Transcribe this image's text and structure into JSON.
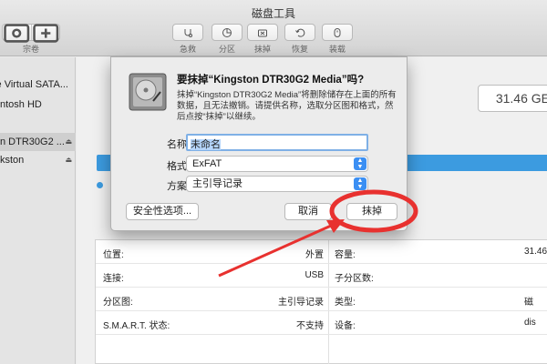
{
  "window": {
    "title": "磁盘工具"
  },
  "toolbar": {
    "volume_label": "宗卷",
    "items": [
      {
        "label": "急救",
        "icon": "stethoscope-icon"
      },
      {
        "label": "分区",
        "icon": "pie-chart-icon"
      },
      {
        "label": "抹掉",
        "icon": "erase-icon"
      },
      {
        "label": "恢复",
        "icon": "restore-icon"
      },
      {
        "label": "装载",
        "icon": "mount-icon"
      }
    ]
  },
  "sidebar": {
    "items": [
      {
        "label": "e Virtual SATA..."
      },
      {
        "label": "ntosh HD"
      },
      {
        "label": "n DTR30G2 ...",
        "selected": true
      },
      {
        "label": "kston"
      }
    ]
  },
  "main": {
    "capacity": "31.46 GE",
    "info": [
      {
        "k1": "位置:",
        "v1": "外置",
        "k2": "容量:",
        "v2": "31.46 G"
      },
      {
        "k1": "连接:",
        "v1": "USB",
        "k2": "子分区数:",
        "v2": ""
      },
      {
        "k1": "分区图:",
        "v1": "主引导记录",
        "k2": "类型:",
        "v2": "磁"
      },
      {
        "k1": "S.M.A.R.T. 状态:",
        "v1": "不支持",
        "k2": "设备:",
        "v2": "dis"
      }
    ]
  },
  "dialog": {
    "title": "要抹掉“Kingston DTR30G2 Media”吗?",
    "description": "抹掉“Kingston DTR30G2 Media”将删除储存在上面的所有数据，且无法撤销。请提供名称，选取分区图和格式，然后点按“抹掉”以继续。",
    "name_label": "名称:",
    "name_value": "未命名",
    "format_label": "格式:",
    "format_value": "ExFAT",
    "scheme_label": "方案:",
    "scheme_value": "主引导记录",
    "security_button": "安全性选项...",
    "cancel_button": "取消",
    "erase_button": "抹掉"
  },
  "colors": {
    "accent": "#3c9be0",
    "annotation": "#e8312f"
  }
}
